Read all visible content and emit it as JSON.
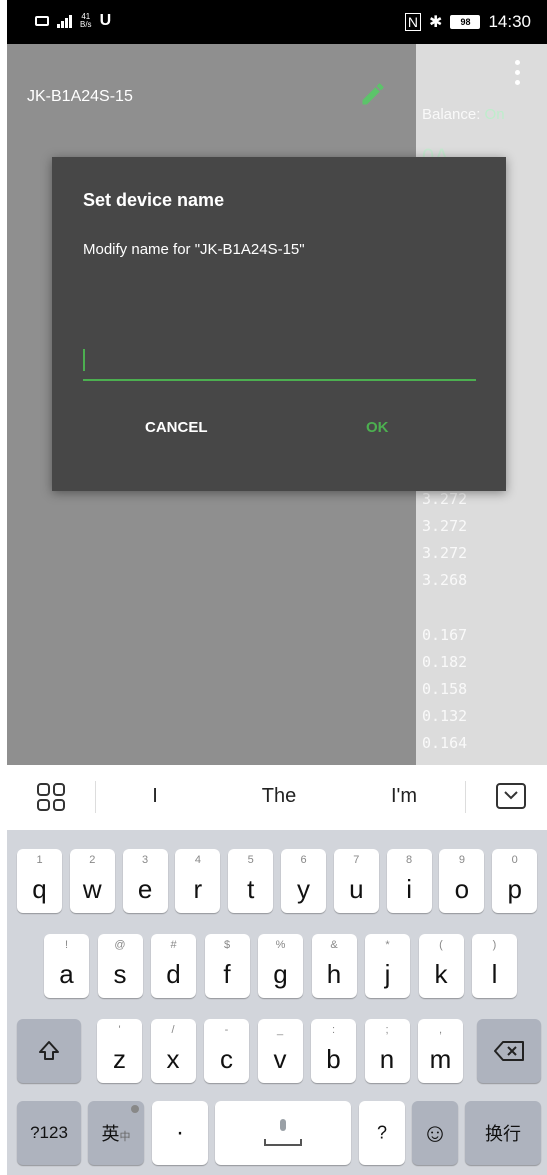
{
  "status_bar": {
    "net_speed_value": "41",
    "net_speed_unit": "B/s",
    "battery": "98",
    "time": "14:30"
  },
  "app": {
    "device_name": "JK-B1A24S-15",
    "balance_label": "Balance:",
    "balance_value": "On",
    "faint_glyph": "0A",
    "cell_voltages": [
      "3.272",
      "3.272",
      "3.272",
      "3.268"
    ],
    "cell_resistances": [
      "0.167",
      "0.182",
      "0.158",
      "0.132",
      "0.164"
    ]
  },
  "dialog": {
    "title": "Set device name",
    "message": "Modify name for \"JK-B1A24S-15\"",
    "input_value": "",
    "cancel_label": "CANCEL",
    "ok_label": "OK",
    "accent_color": "#4caf50"
  },
  "keyboard": {
    "suggestions": [
      "I",
      "The",
      "I'm"
    ],
    "row1": [
      {
        "main": "q",
        "sec": "1"
      },
      {
        "main": "w",
        "sec": "2"
      },
      {
        "main": "e",
        "sec": "3"
      },
      {
        "main": "r",
        "sec": "4"
      },
      {
        "main": "t",
        "sec": "5"
      },
      {
        "main": "y",
        "sec": "6"
      },
      {
        "main": "u",
        "sec": "7"
      },
      {
        "main": "i",
        "sec": "8"
      },
      {
        "main": "o",
        "sec": "9"
      },
      {
        "main": "p",
        "sec": "0"
      }
    ],
    "row2": [
      {
        "main": "a",
        "sec": "!"
      },
      {
        "main": "s",
        "sec": "@"
      },
      {
        "main": "d",
        "sec": "#"
      },
      {
        "main": "f",
        "sec": "$"
      },
      {
        "main": "g",
        "sec": "%"
      },
      {
        "main": "h",
        "sec": "&"
      },
      {
        "main": "j",
        "sec": "*"
      },
      {
        "main": "k",
        "sec": "("
      },
      {
        "main": "l",
        "sec": ")"
      }
    ],
    "row3": [
      {
        "main": "z",
        "sec": "'"
      },
      {
        "main": "x",
        "sec": "/"
      },
      {
        "main": "c",
        "sec": "-"
      },
      {
        "main": "v",
        "sec": "_"
      },
      {
        "main": "b",
        "sec": ":"
      },
      {
        "main": "n",
        "sec": ";"
      },
      {
        "main": "m",
        "sec": ","
      }
    ],
    "numbers_label": "?123",
    "lang_label": "英",
    "lang_sub": "中",
    "dot_label": "·",
    "question_label": "?",
    "emoji_label": "☺",
    "enter_label": "换行"
  }
}
